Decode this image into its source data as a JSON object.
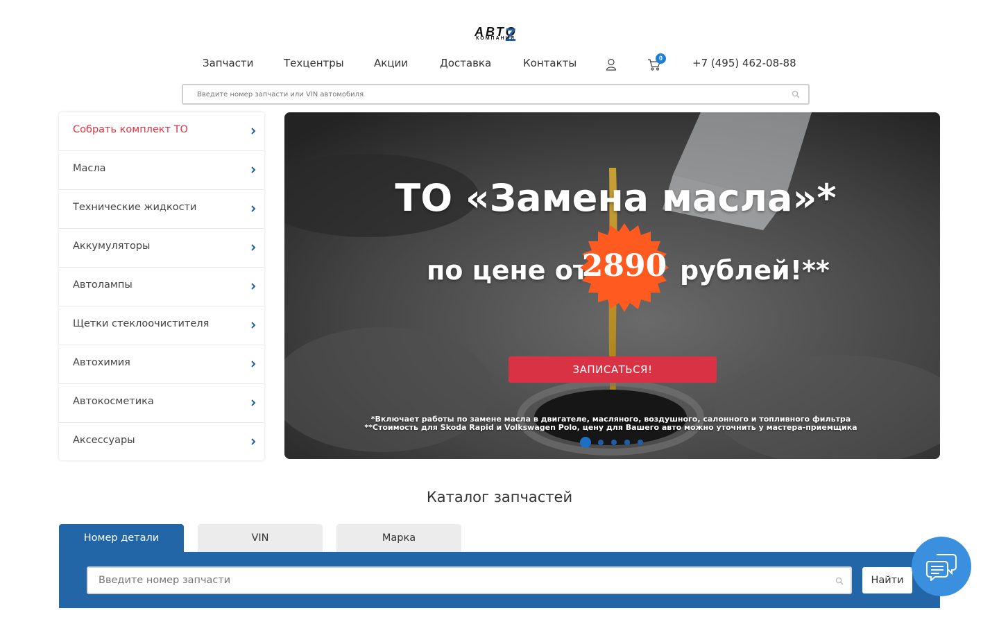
{
  "logo": {
    "text": "АВТО",
    "sub": "КОМПАНИЯ",
    "mark": "Z"
  },
  "nav": {
    "items": [
      "Запчасти",
      "Техцентры",
      "Акции",
      "Доставка",
      "Контакты"
    ],
    "cart_count": "0",
    "phone": "+7 (495) 462-08-88",
    "icons": [
      "user-icon",
      "cart-icon"
    ]
  },
  "search": {
    "placeholder": "Введите номер запчасти или VIN автомобиля"
  },
  "sidebar": {
    "items": [
      {
        "label": "Собрать комплект ТО",
        "active": true
      },
      {
        "label": "Масла"
      },
      {
        "label": "Технические жидкости"
      },
      {
        "label": "Аккумуляторы"
      },
      {
        "label": "Автолампы"
      },
      {
        "label": "Щетки стеклоочистителя"
      },
      {
        "label": "Автохимия"
      },
      {
        "label": "Автокосметика"
      },
      {
        "label": "Аксессуары"
      }
    ]
  },
  "banner": {
    "title": "ТО «Замена масла»*",
    "price_prefix": "по цене от",
    "price": "2890",
    "price_suffix": "рублей!**",
    "button": "ЗАПИСАТЬСЯ!",
    "note1": "*Включает работы по замене масла в двигателе, масляного, воздушного, салонного и топливного фильтра",
    "note2": "**Стоимость для Skoda Rapid и Volkswagen Polo, цену для Вашего авто можно уточнить у мастера-приемщика",
    "slides_total": 5,
    "slide_active": 1,
    "accent_color": "#ff5a1f",
    "button_color": "#d83244"
  },
  "catalog": {
    "title": "Каталог запчастей",
    "tabs": [
      "Номер детали",
      "VIN",
      "Марка"
    ],
    "active_tab": 0,
    "input_placeholder": "Введите номер запчасти",
    "find_label": "Найти",
    "panel_color": "#2266a8"
  },
  "chat": {
    "icon": "chat-icon"
  }
}
